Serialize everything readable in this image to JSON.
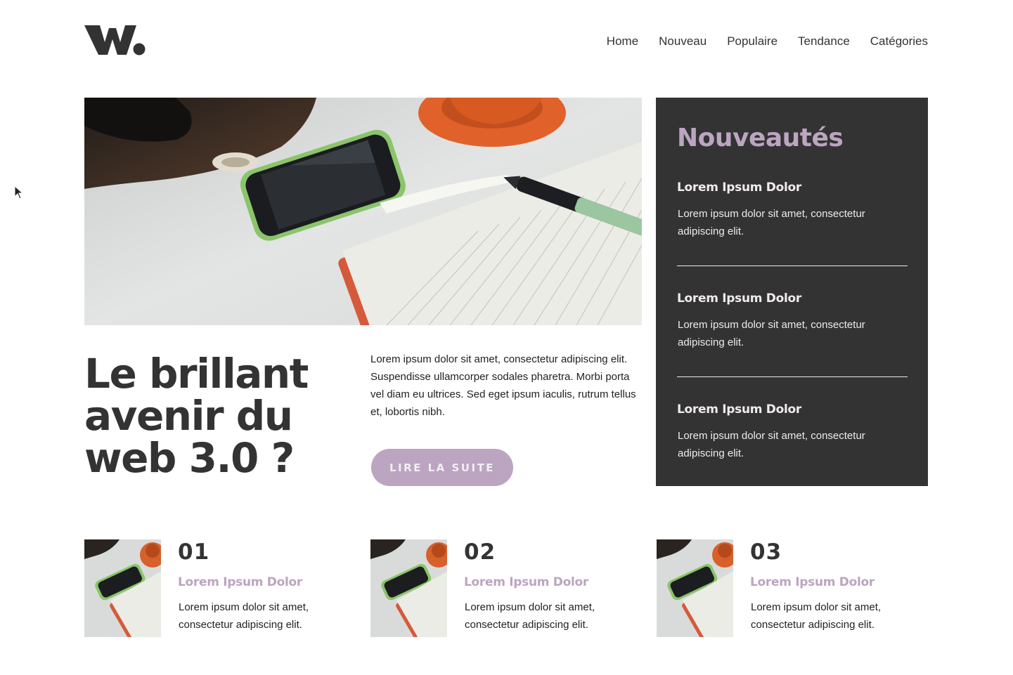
{
  "logo": {
    "text": "W."
  },
  "nav": {
    "items": [
      "Home",
      "Nouveau",
      "Populaire",
      "Tendance",
      "Catégories"
    ]
  },
  "hero": {
    "image_icon": "desk-photo-icon",
    "title": "Le brillant avenir du web 3.0 ?",
    "intro": "Lorem ipsum dolor sit amet, consectetur adipiscing elit. Suspendisse ullamcorper sodales pharetra. Morbi porta vel diam eu ultrices. Sed eget ipsum iaculis, rutrum tellus et, lobortis nibh.",
    "cta_label": "LIRE LA SUITE"
  },
  "sidebar": {
    "title": "Nouveautés",
    "items": [
      {
        "title": "Lorem Ipsum Dolor",
        "text": "Lorem ipsum dolor sit amet, consectetur adipiscing elit."
      },
      {
        "title": "Lorem Ipsum Dolor",
        "text": "Lorem ipsum dolor sit amet, consectetur adipiscing elit."
      },
      {
        "title": "Lorem Ipsum Dolor",
        "text": "Lorem ipsum dolor sit amet, consectetur adipiscing elit."
      }
    ]
  },
  "cards": [
    {
      "number": "01",
      "title": "Lorem Ipsum Dolor",
      "text": "Lorem ipsum dolor sit amet, consectetur adipiscing elit."
    },
    {
      "number": "02",
      "title": "Lorem Ipsum Dolor",
      "text": "Lorem ipsum dolor sit amet, consectetur adipiscing elit."
    },
    {
      "number": "03",
      "title": "Lorem Ipsum Dolor",
      "text": "Lorem ipsum dolor sit amet, consectetur adipiscing elit."
    }
  ],
  "colors": {
    "accent": "#bba5c0",
    "dark": "#333333",
    "background": "#ffffff"
  }
}
